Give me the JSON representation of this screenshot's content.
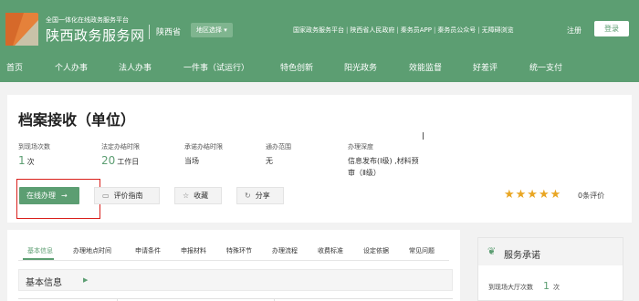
{
  "header": {
    "site_subtitle": "全国一体化在线政务服务平台",
    "site_title": "陕西政务服务网",
    "province": "陕西省",
    "region_select": "地区选择",
    "top_links": [
      "国家政务服务平台",
      "陕西省人民政府",
      "秦务员APP",
      "秦务员公众号",
      "无障碍浏览"
    ],
    "login": "注册",
    "register": "登录",
    "brand_color": "#5c9e72"
  },
  "nav": [
    "首页",
    "个人办事",
    "法人办事",
    "一件事（试运行）",
    "特色创新",
    "阳光政务",
    "效能监督",
    "好差评",
    "统一支付"
  ],
  "item": {
    "title": "档案接收（单位）",
    "stats": [
      {
        "label": "到现场次数",
        "value": "1",
        "unit": "次"
      },
      {
        "label": "法定办结时限",
        "value": "20",
        "unit": "工作日"
      },
      {
        "label": "承诺办结时限",
        "value": "当场"
      },
      {
        "label": "通办范围",
        "value": "无"
      },
      {
        "label": "办理深度",
        "value": "信息发布(Ⅰ级) ,材料预审（Ⅱ级）"
      }
    ],
    "actions": {
      "online": "在线办理",
      "guide": "评价指南",
      "favorite": "收藏",
      "share": "分享"
    },
    "rating": {
      "stars": 5,
      "count_text": "0条评价"
    }
  },
  "tabs": [
    "基本信息",
    "办理地点时间",
    "申请条件",
    "申报材料",
    "特殊环节",
    "办理流程",
    "收费标准",
    "设定依据",
    "常见问题"
  ],
  "section": {
    "title": "基本信息"
  },
  "side": {
    "title": "服务承诺",
    "label": "到现场大厅次数",
    "value": "1",
    "unit": "次"
  }
}
